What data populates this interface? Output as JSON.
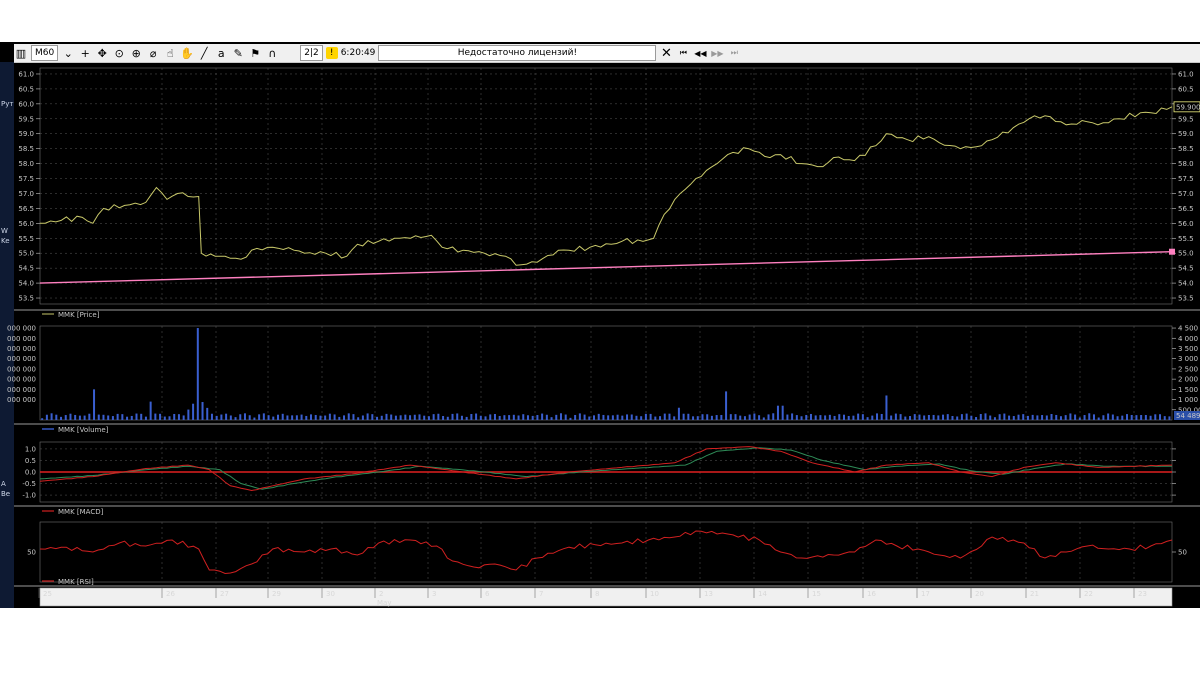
{
  "toolbar": {
    "timeframe": "M60",
    "page_counter": "2|2",
    "time": "6:20:49",
    "message": "Недостаточно лицензий!",
    "items": [
      "chart-icon",
      "crosshair-icon",
      "move-icon",
      "target-icon",
      "zoom-icon",
      "ruler-icon",
      "hand-icon",
      "pan-icon",
      "line-tool-icon",
      "text-tool-icon",
      "brush-icon",
      "flag-icon",
      "magnet-icon"
    ]
  },
  "left_strip": [
    "Рут",
    "W",
    "Ke",
    "A",
    "Be"
  ],
  "colors": {
    "background": "#000000",
    "price": "#c9c96a",
    "trend": "#ff80c0",
    "volume": "#3a5fd0",
    "macd": "#d02020",
    "macd_signal": "#2e8b57",
    "rsi": "#d02020",
    "grid": "#5a5a5a",
    "last_price_box": "#f0f080"
  },
  "chart_data": [
    {
      "panel": "price",
      "type": "line",
      "legend": "MMK [Price]",
      "ylim": [
        53.3,
        61.2
      ],
      "yticks": [
        "61.0",
        "60.5",
        "60.0",
        "59.5",
        "59.0",
        "58.5",
        "58.0",
        "57.5",
        "57.0",
        "56.5",
        "56.0",
        "55.5",
        "55.0",
        "54.5",
        "54.0",
        "53.5"
      ],
      "last_value_label": "59.900",
      "x_range": [
        0,
        21.4
      ],
      "series": [
        {
          "name": "MMK",
          "points": [
            [
              0,
              56.0
            ],
            [
              0.4,
              56.1
            ],
            [
              0.8,
              56.2
            ],
            [
              1.0,
              56.0
            ],
            [
              1.2,
              56.5
            ],
            [
              1.6,
              56.6
            ],
            [
              2.0,
              56.7
            ],
            [
              2.2,
              57.2
            ],
            [
              2.4,
              56.8
            ],
            [
              2.6,
              57.0
            ],
            [
              2.8,
              56.9
            ],
            [
              3.0,
              56.9
            ],
            [
              3.05,
              55.0
            ],
            [
              3.4,
              54.9
            ],
            [
              3.8,
              54.8
            ],
            [
              4.0,
              55.1
            ],
            [
              4.4,
              55.2
            ],
            [
              4.8,
              55.1
            ],
            [
              5.0,
              55.0
            ],
            [
              5.4,
              55.0
            ],
            [
              5.8,
              54.9
            ],
            [
              6.0,
              55.3
            ],
            [
              6.4,
              55.4
            ],
            [
              6.8,
              55.5
            ],
            [
              7.0,
              55.5
            ],
            [
              7.4,
              55.6
            ],
            [
              7.6,
              55.2
            ],
            [
              8.0,
              55.1
            ],
            [
              8.4,
              55.0
            ],
            [
              8.8,
              54.9
            ],
            [
              9.0,
              54.6
            ],
            [
              9.4,
              54.7
            ],
            [
              9.8,
              55.1
            ],
            [
              10.0,
              55.1
            ],
            [
              10.4,
              55.2
            ],
            [
              10.8,
              55.3
            ],
            [
              11.0,
              55.4
            ],
            [
              11.4,
              55.4
            ],
            [
              11.6,
              55.5
            ],
            [
              11.8,
              56.3
            ],
            [
              12.0,
              56.8
            ],
            [
              12.4,
              57.5
            ],
            [
              12.8,
              58.0
            ],
            [
              13.0,
              58.3
            ],
            [
              13.4,
              58.5
            ],
            [
              13.8,
              58.2
            ],
            [
              14.0,
              58.3
            ],
            [
              14.4,
              58.0
            ],
            [
              14.8,
              57.9
            ],
            [
              15.0,
              58.2
            ],
            [
              15.4,
              58.1
            ],
            [
              15.8,
              58.6
            ],
            [
              16.0,
              59.0
            ],
            [
              16.4,
              58.8
            ],
            [
              16.8,
              58.9
            ],
            [
              17.0,
              58.7
            ],
            [
              17.4,
              58.5
            ],
            [
              17.8,
              58.6
            ],
            [
              18.0,
              58.8
            ],
            [
              18.4,
              59.2
            ],
            [
              18.8,
              59.6
            ],
            [
              19.0,
              59.6
            ],
            [
              19.4,
              59.3
            ],
            [
              19.8,
              59.4
            ],
            [
              20.0,
              59.3
            ],
            [
              20.4,
              59.5
            ],
            [
              20.8,
              59.7
            ],
            [
              21.0,
              59.7
            ],
            [
              21.4,
              59.9
            ]
          ]
        },
        {
          "name": "Trend",
          "points": [
            [
              0,
              54.0
            ],
            [
              21.4,
              55.05
            ]
          ]
        }
      ]
    },
    {
      "panel": "volume",
      "type": "bar",
      "legend": "MMK [Volume]",
      "ylim": [
        0,
        4600000
      ],
      "yticks_right": [
        "4 500 000",
        "4 000 000",
        "3 500 000",
        "3 000 000",
        "2 500 000",
        "2 000 000",
        "1 500 000",
        "1 000 000",
        "500 000"
      ],
      "yticks_left": [
        "000 000",
        "000 000",
        "000 000",
        "000 000",
        "000 000",
        "000 000",
        "000 000",
        "000 000"
      ],
      "last_value_label": "54 489",
      "x_range": [
        0,
        21.4
      ],
      "spikes": [
        [
          1.0,
          1500000
        ],
        [
          2.1,
          900000
        ],
        [
          3.0,
          4500000
        ],
        [
          13.0,
          1400000
        ],
        [
          16.0,
          1200000
        ],
        [
          14.0,
          700000
        ],
        [
          12.1,
          600000
        ]
      ],
      "baseline": 220000
    },
    {
      "panel": "macd",
      "type": "line",
      "legend": "MMK [MACD]",
      "ylim": [
        -1.3,
        1.3
      ],
      "yticks": [
        "1.0",
        "0.5",
        "0.0",
        "-0.5",
        "-1.0"
      ],
      "x_range": [
        0,
        21.4
      ],
      "series": [
        {
          "name": "MACD",
          "points": [
            [
              0,
              -0.4
            ],
            [
              1,
              -0.2
            ],
            [
              2,
              0.15
            ],
            [
              2.8,
              0.3
            ],
            [
              3.2,
              0.1
            ],
            [
              3.6,
              -0.6
            ],
            [
              4.0,
              -0.8
            ],
            [
              4.4,
              -0.6
            ],
            [
              5.0,
              -0.3
            ],
            [
              6.0,
              -0.05
            ],
            [
              7.0,
              0.3
            ],
            [
              8.0,
              0.0
            ],
            [
              9.0,
              -0.3
            ],
            [
              10.0,
              0.0
            ],
            [
              11.0,
              0.2
            ],
            [
              12.0,
              0.4
            ],
            [
              12.6,
              1.0
            ],
            [
              13.4,
              1.1
            ],
            [
              14.0,
              0.9
            ],
            [
              14.6,
              0.4
            ],
            [
              15.4,
              0.0
            ],
            [
              16.0,
              0.3
            ],
            [
              16.8,
              0.4
            ],
            [
              17.4,
              0.0
            ],
            [
              18.0,
              -0.2
            ],
            [
              18.6,
              0.2
            ],
            [
              19.2,
              0.4
            ],
            [
              20.0,
              0.2
            ],
            [
              21.4,
              0.3
            ]
          ]
        },
        {
          "name": "Signal",
          "points": [
            [
              0,
              -0.3
            ],
            [
              1,
              -0.15
            ],
            [
              2,
              0.1
            ],
            [
              2.8,
              0.25
            ],
            [
              3.4,
              0.1
            ],
            [
              3.8,
              -0.5
            ],
            [
              4.2,
              -0.75
            ],
            [
              4.8,
              -0.5
            ],
            [
              5.5,
              -0.25
            ],
            [
              6.4,
              0.0
            ],
            [
              7.2,
              0.25
            ],
            [
              8.2,
              0.05
            ],
            [
              9.2,
              -0.2
            ],
            [
              10.2,
              0.0
            ],
            [
              11.2,
              0.15
            ],
            [
              12.2,
              0.3
            ],
            [
              12.8,
              0.9
            ],
            [
              13.6,
              1.05
            ],
            [
              14.2,
              0.95
            ],
            [
              14.8,
              0.5
            ],
            [
              15.6,
              0.1
            ],
            [
              16.2,
              0.25
            ],
            [
              17.0,
              0.35
            ],
            [
              17.6,
              0.05
            ],
            [
              18.2,
              -0.1
            ],
            [
              18.8,
              0.15
            ],
            [
              19.4,
              0.35
            ],
            [
              20.2,
              0.25
            ],
            [
              21.4,
              0.25
            ]
          ]
        }
      ]
    },
    {
      "panel": "rsi",
      "type": "line",
      "legend": "MMK [RSI]",
      "ylim": [
        0,
        100
      ],
      "yticks": [
        "50"
      ],
      "x_range": [
        0,
        21.4
      ],
      "series": [
        {
          "name": "RSI",
          "points": [
            [
              0,
              55
            ],
            [
              0.5,
              58
            ],
            [
              1.0,
              50
            ],
            [
              1.5,
              65
            ],
            [
              2.0,
              60
            ],
            [
              2.5,
              70
            ],
            [
              3.0,
              55
            ],
            [
              3.2,
              20
            ],
            [
              3.6,
              15
            ],
            [
              4.0,
              30
            ],
            [
              4.4,
              55
            ],
            [
              5.0,
              50
            ],
            [
              5.5,
              55
            ],
            [
              6.0,
              45
            ],
            [
              6.4,
              65
            ],
            [
              7.0,
              70
            ],
            [
              7.5,
              60
            ],
            [
              7.8,
              35
            ],
            [
              8.2,
              25
            ],
            [
              8.6,
              30
            ],
            [
              9.0,
              20
            ],
            [
              9.4,
              40
            ],
            [
              10.0,
              58
            ],
            [
              10.5,
              62
            ],
            [
              11.0,
              65
            ],
            [
              11.5,
              70
            ],
            [
              12.0,
              75
            ],
            [
              12.4,
              85
            ],
            [
              13.0,
              80
            ],
            [
              13.6,
              70
            ],
            [
              14.0,
              50
            ],
            [
              14.4,
              40
            ],
            [
              15.0,
              45
            ],
            [
              15.4,
              50
            ],
            [
              15.8,
              70
            ],
            [
              16.2,
              60
            ],
            [
              16.6,
              55
            ],
            [
              17.0,
              45
            ],
            [
              17.4,
              40
            ],
            [
              17.8,
              60
            ],
            [
              18.0,
              75
            ],
            [
              18.6,
              65
            ],
            [
              19.0,
              40
            ],
            [
              19.4,
              50
            ],
            [
              19.8,
              60
            ],
            [
              20.2,
              55
            ],
            [
              20.6,
              55
            ],
            [
              21.0,
              60
            ],
            [
              21.4,
              70
            ]
          ]
        }
      ]
    }
  ],
  "x_axis": {
    "tick_labels": [
      "25",
      "26",
      "27",
      "29",
      "30",
      "2",
      "3",
      "6",
      "7",
      "8",
      "10",
      "13",
      "14",
      "15",
      "16",
      "17",
      "20",
      "21",
      "22",
      "23"
    ],
    "month_label": "May"
  }
}
